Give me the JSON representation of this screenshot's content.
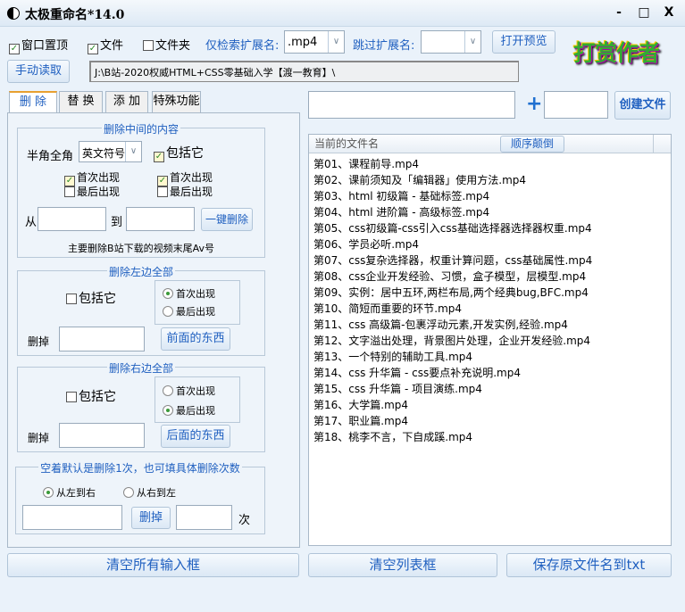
{
  "window": {
    "title": "太极重命名*14.0",
    "minimize": "-",
    "maximize": "□",
    "close": "X"
  },
  "options": {
    "always_on_top": {
      "label": "窗口置顶",
      "checked": true
    },
    "files": {
      "label": "文件",
      "checked": true
    },
    "folders": {
      "label": "文件夹",
      "checked": false
    },
    "only_ext_label": "仅检索扩展名:",
    "only_ext_value": ".mp4",
    "skip_ext_label": "跳过扩展名:",
    "skip_ext_value": "",
    "open_preview": "打开预览",
    "donate_logo": "打赏作者"
  },
  "path": {
    "read_button": "手动读取",
    "value": "J:\\B站-2020权威HTML+CSS零基础入学【渡一教育】\\"
  },
  "tabs": [
    {
      "label": "删 除",
      "active": true
    },
    {
      "label": "替 换"
    },
    {
      "label": "添 加"
    },
    {
      "label": "特殊功能"
    }
  ],
  "delete_middle": {
    "title": "删除中间的内容",
    "width_label": "半角全角",
    "width_value": "英文符号",
    "include": "包括它",
    "left_first": "首次出现",
    "left_last": "最后出现",
    "right_first": "首次出现",
    "right_last": "最后出现",
    "from": "从",
    "to": "到",
    "button": "一键删除",
    "note": "主要删除B站下载的视频末尾Av号"
  },
  "delete_left": {
    "title": "删除左边全部",
    "include": "包括它",
    "first": "首次出现",
    "last": "最后出现",
    "remove_label": "删掉",
    "button": "前面的东西",
    "selected": "首次出现"
  },
  "delete_right": {
    "title": "删除右边全部",
    "include": "包括它",
    "first": "首次出现",
    "last": "最后出现",
    "remove_label": "删掉",
    "button": "后面的东西",
    "selected": "最后出现"
  },
  "count_group": {
    "title": "空着默认是删除1次，也可填具体删除次数",
    "ltr": "从左到右",
    "rtl": "从右到左",
    "button": "删掉",
    "times": "次"
  },
  "create": {
    "plus": "+",
    "button": "创建文件"
  },
  "file_list": {
    "header": "当前的文件名",
    "reverse_button": "顺序颠倒",
    "items": [
      "第01、课程前导.mp4",
      "第02、课前须知及「编辑器」使用方法.mp4",
      "第03、html 初级篇 - 基础标签.mp4",
      "第04、html 进阶篇 - 高级标签.mp4",
      "第05、css初级篇-css引入css基础选择器选择器权重.mp4",
      "第06、学员必听.mp4",
      "第07、css复杂选择器，权重计算问题，css基础属性.mp4",
      "第08、css企业开发经验、习惯，盒子模型，层模型.mp4",
      "第09、实例：居中五环,两栏布局,两个经典bug,BFC.mp4",
      "第10、简短而重要的环节.mp4",
      "第11、css 高级篇-包裹浮动元素,开发实例,经验.mp4",
      "第12、文字溢出处理，背景图片处理，企业开发经验.mp4",
      "第13、一个特别的辅助工具.mp4",
      "第14、css 升华篇 - css要点补充说明.mp4",
      "第15、css 升华篇 - 项目演练.mp4",
      "第16、大学篇.mp4",
      "第17、职业篇.mp4",
      "第18、桃李不言，下自成蹊.mp4"
    ]
  },
  "bottom": {
    "clear_inputs": "清空所有输入框",
    "clear_list": "清空列表框",
    "save_names": "保存原文件名到txt"
  }
}
